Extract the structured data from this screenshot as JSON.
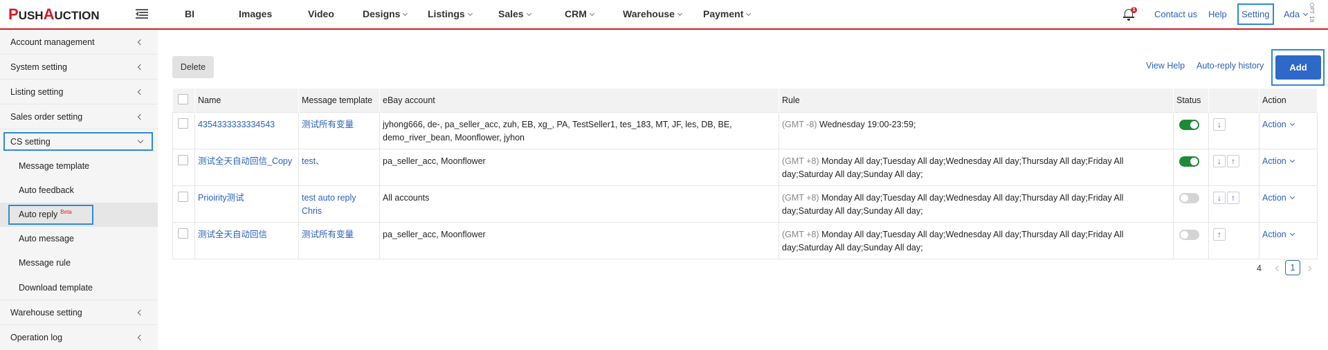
{
  "brand": {
    "logo_p": "P",
    "logo_ush": "USH",
    "logo_a": "A",
    "logo_uction": "UCTION"
  },
  "nav": {
    "items": [
      {
        "label": "BI"
      },
      {
        "label": "Images"
      },
      {
        "label": "Video"
      },
      {
        "label": "Designs"
      },
      {
        "label": "Listings"
      },
      {
        "label": "Sales"
      },
      {
        "label": "CRM"
      },
      {
        "label": "Warehouse"
      },
      {
        "label": "Payment"
      }
    ],
    "notification_count": "1",
    "contact_label": "Contact us",
    "help_label": "Help",
    "setting_label": "Setting",
    "user_label": "Ada",
    "version_label": "OPT 18"
  },
  "sidebar": {
    "items": [
      {
        "label": "Account management"
      },
      {
        "label": "System setting"
      },
      {
        "label": "Listing setting"
      },
      {
        "label": "Sales order setting"
      },
      {
        "label": "CS setting"
      },
      {
        "label": "Warehouse setting"
      },
      {
        "label": "Operation log"
      }
    ],
    "sub_items": [
      {
        "label": "Message template"
      },
      {
        "label": "Auto feedback"
      },
      {
        "label": "Auto reply"
      },
      {
        "label": "Auto message"
      },
      {
        "label": "Message rule"
      },
      {
        "label": "Download template"
      }
    ],
    "beta_label": "Beta"
  },
  "toolbar": {
    "delete_label": "Delete",
    "view_help_label": "View Help",
    "history_label": "Auto-reply history",
    "add_label": "Add"
  },
  "table": {
    "headers": {
      "name": "Name",
      "template": "Message template",
      "account": "eBay account",
      "rule": "Rule",
      "status": "Status",
      "action": "Action"
    },
    "rows": [
      {
        "name": "4354333333334543",
        "template": "测试所有变量",
        "template2": "",
        "account": "jyhong666, de-, pa_seller_acc, zuh, EB, xg_, PA, TestSeller1, tes_183, MT, JF, les, DB, BE, demo_river_bean, Moonflower, jyhon",
        "gmt": "(GMT -8)",
        "rule": "Wednesday 19:00-23:59;",
        "status": "on",
        "action": "Action"
      },
      {
        "name": "测试全天自动回信_Copy",
        "template": "test、",
        "template2": "",
        "account": "pa_seller_acc, Moonflower",
        "gmt": "(GMT +8)",
        "rule": "Monday All day;Tuesday All day;Wednesday All day;Thursday All day;Friday All day;Saturday All day;Sunday All day;",
        "status": "on",
        "action": "Action"
      },
      {
        "name": "Prioirity测试",
        "template": "test auto reply",
        "template2": "Chris",
        "account": "All accounts",
        "gmt": "(GMT +8)",
        "rule": "Monday All day;Tuesday All day;Wednesday All day;Thursday All day;Friday All day;Saturday All day;Sunday All day;",
        "status": "off",
        "action": "Action"
      },
      {
        "name": "测试全天自动回信",
        "template": "测试所有变量",
        "template2": "",
        "account": "pa_seller_acc, Moonflower",
        "gmt": "(GMT +8)",
        "rule": "Monday All day;Tuesday All day;Wednesday All day;Thursday All day;Friday All day;Saturday All day;Sunday All day;",
        "status": "off",
        "action": "Action"
      }
    ]
  },
  "pagination": {
    "total": "4",
    "current_page": "1"
  },
  "colors": {
    "brand_red": "#d71920",
    "link_blue": "#2a63b8",
    "primary": "#2e68c9",
    "toggle_on": "#1e8a3a",
    "highlight": "#2a8bd6"
  },
  "icons": {
    "bell": "bell-icon",
    "menu": "menu-toggle-icon",
    "move_down": "arrow-down-icon",
    "move_up": "arrow-up-icon"
  }
}
